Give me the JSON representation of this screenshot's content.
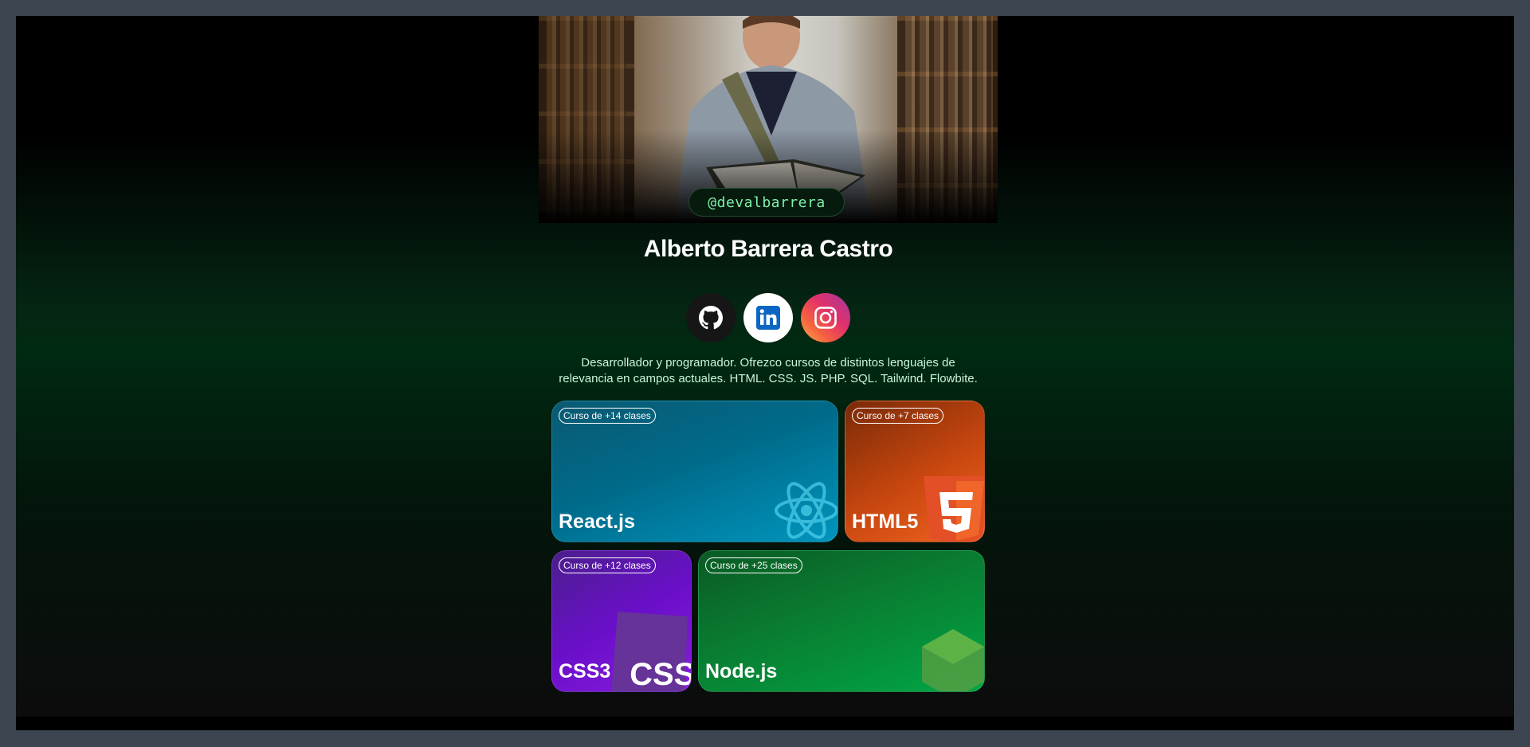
{
  "profile": {
    "handle": "@devalbarrera",
    "name": "Alberto Barrera Castro",
    "bio": "Desarrollador y programador. Ofrezco cursos de distintos lenguajes de relevancia en campos actuales. HTML. CSS. JS. PHP. SQL. Tailwind. Flowbite."
  },
  "social": [
    {
      "name": "GitHub",
      "icon": "github-icon",
      "color": "#161616"
    },
    {
      "name": "LinkedIn",
      "icon": "linkedin-icon",
      "color": "#0a66c2"
    },
    {
      "name": "Instagram",
      "icon": "instagram-icon",
      "color": "#e1306c"
    }
  ],
  "courses": [
    {
      "title": "React.js",
      "badge": "Curso de +14 clases",
      "icon": "react-icon",
      "color": "#0095bd"
    },
    {
      "title": "HTML5",
      "badge": "Curso de +7 clases",
      "icon": "html5-icon",
      "color": "#e34f26"
    },
    {
      "title": "CSS3",
      "badge": "Curso de +12 clases",
      "icon": "css-icon",
      "color": "#6a0fc9"
    },
    {
      "title": "Node.js",
      "badge": "Curso de +25 clases",
      "icon": "nodejs-icon",
      "color": "#00a646"
    }
  ],
  "theme": {
    "accent": "#7ef0a8",
    "frame": "#3d4550"
  }
}
